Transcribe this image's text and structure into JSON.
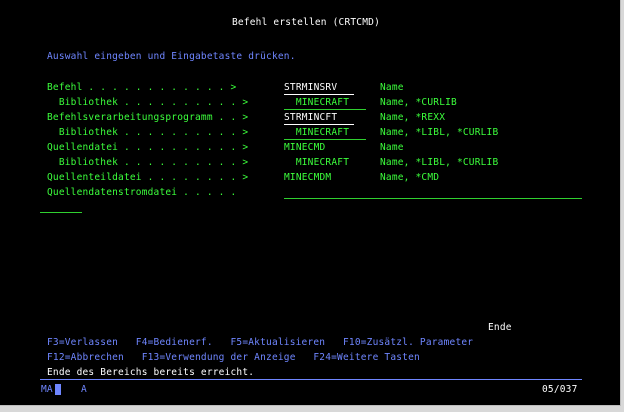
{
  "screen": {
    "title": "Befehl erstellen (CRTCMD)",
    "instruction": "Auswahl eingeben und Eingabetaste drücken.",
    "rows": [
      {
        "label": "Befehl . . . . . . . . . . . . >",
        "value": "STRMINSRV",
        "hint": "Name"
      },
      {
        "label": "  Bibliothek . . . . . . . . . . >",
        "value": "  MINECRAFT",
        "hint": "Name, *CURLIB"
      },
      {
        "label": "Befehlsverarbeitungsprogramm . . >",
        "value": "STRMINCFT",
        "hint": "Name, *REXX"
      },
      {
        "label": "  Bibliothek . . . . . . . . . . >",
        "value": "  MINECRAFT",
        "hint": "Name, *LIBL, *CURLIB"
      },
      {
        "label": "Quellendatei . . . . . . . . . . >",
        "value": "MINECMD",
        "hint": "Name"
      },
      {
        "label": "  Bibliothek . . . . . . . . . . >",
        "value": "  MINECRAFT",
        "hint": "Name, *LIBL, *CURLIB"
      },
      {
        "label": "Quellenteildatei . . . . . . . . >",
        "value": "MINECMDM",
        "hint": "Name, *CMD"
      },
      {
        "label": "Quellendatenstromdatei . . . . .",
        "value": "",
        "hint": ""
      }
    ],
    "end_marker": "Ende",
    "fkeys_line1": "F3=Verlassen   F4=Bedienerf.   F5=Aktualisieren   F10=Zusätzl. Parameter",
    "fkeys_line2": "F12=Abbrechen   F13=Verwendung der Anzeige   F24=Weitere Tasten",
    "message": "Ende des Bereichs bereits erreicht.",
    "status_left": "MA",
    "status_mid": "A",
    "cursor_pos": "05/037"
  },
  "colors": {
    "background": "#000000",
    "title": "#ffffff",
    "instruction": "#6f86ff",
    "label": "#3cff3c",
    "input": "#3cff3c",
    "current_input": "#ffffff"
  }
}
